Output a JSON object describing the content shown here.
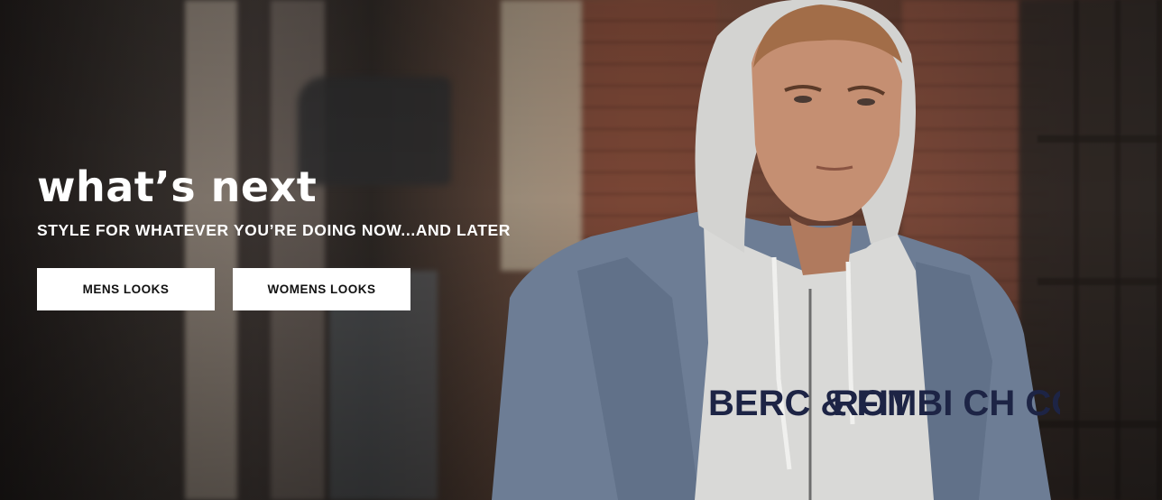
{
  "hero": {
    "headline": "what’s next",
    "subheadline": "STYLE FOR WHATEVER YOU’RE DOING NOW...AND LATER",
    "buttons": {
      "mens_label": "MENS LOOKS",
      "womens_label": "WOMENS LOOKS"
    },
    "image": {
      "hoodie_text_left": "BERC & FIT",
      "hoodie_text_right": "ROMBI CH CO."
    }
  }
}
